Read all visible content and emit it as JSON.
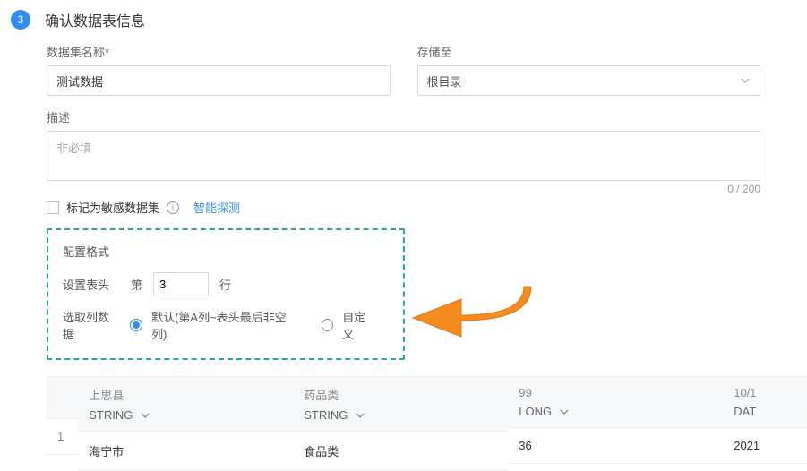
{
  "step": {
    "number": "3",
    "title": "确认数据表信息"
  },
  "form": {
    "name_label": "数据集名称*",
    "name_value": "测试数据",
    "storage_label": "存储至",
    "storage_value": "根目录",
    "desc_label": "描述",
    "desc_placeholder": "非必填",
    "desc_counter": "0 / 200",
    "sensitive_label": "标记为敏感数据集",
    "detect_link": "智能探测"
  },
  "config": {
    "title": "配置格式",
    "header_label": "设置表头",
    "header_prefix": "第",
    "header_value": "3",
    "header_suffix": "行",
    "columns_label": "选取列数据",
    "opt_default": "默认(第A列~表头最后非空列)",
    "opt_custom": "自定义"
  },
  "table": {
    "columns": [
      {
        "name": "上思县",
        "type": "STRING"
      },
      {
        "name": "药品类",
        "type": "STRING"
      },
      {
        "name": "99",
        "type": "LONG"
      },
      {
        "name": "10/1",
        "type": "DAT"
      }
    ],
    "row_index": "1",
    "row": [
      "海宁市",
      "食品类",
      "36",
      "2021"
    ]
  }
}
